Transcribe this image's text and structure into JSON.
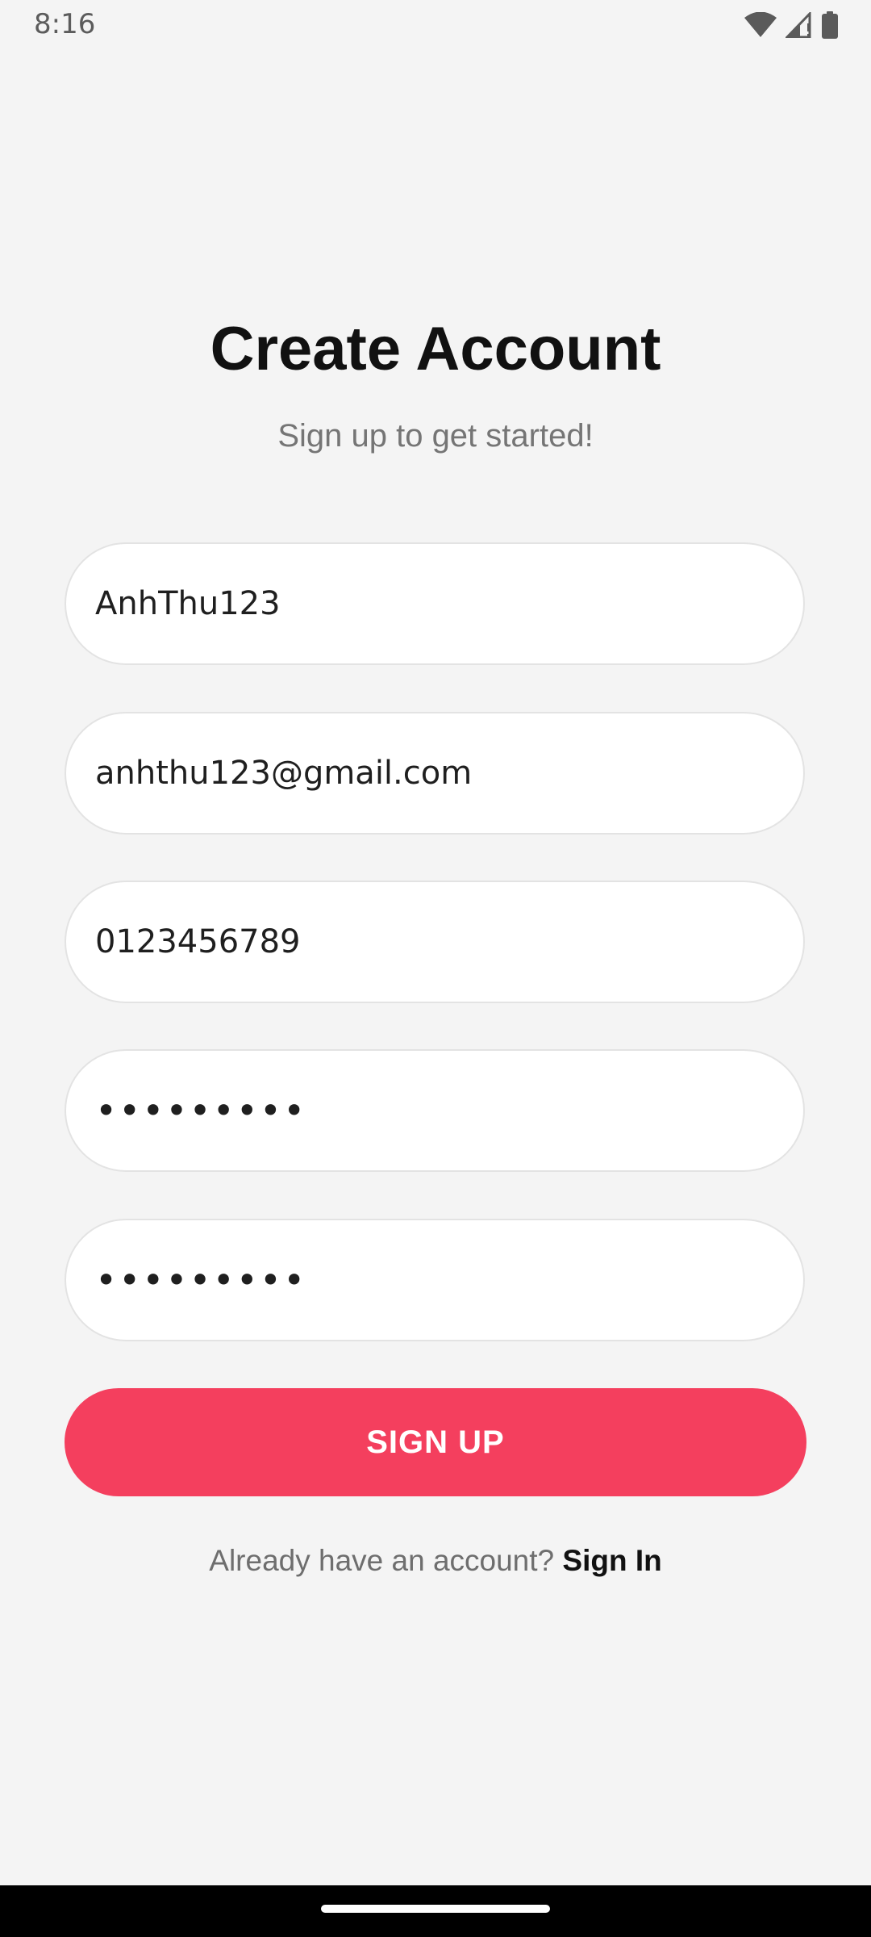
{
  "status_bar": {
    "time": "8:16",
    "icons": [
      "wifi-icon",
      "signal-icon",
      "battery-icon"
    ]
  },
  "header": {
    "title": "Create Account",
    "subtitle": "Sign up to get started!"
  },
  "form": {
    "username_value": "AnhThu123",
    "email_value": "anhthu123@gmail.com",
    "phone_value": "0123456789",
    "password_value": "•••••••••",
    "confirm_password_value": "•••••••••"
  },
  "actions": {
    "signup_label": "SIGN UP",
    "signin_prompt": "Already have an account?",
    "signin_label": "Sign In"
  },
  "colors": {
    "accent": "#f43f5e",
    "background": "#f4f4f4"
  }
}
